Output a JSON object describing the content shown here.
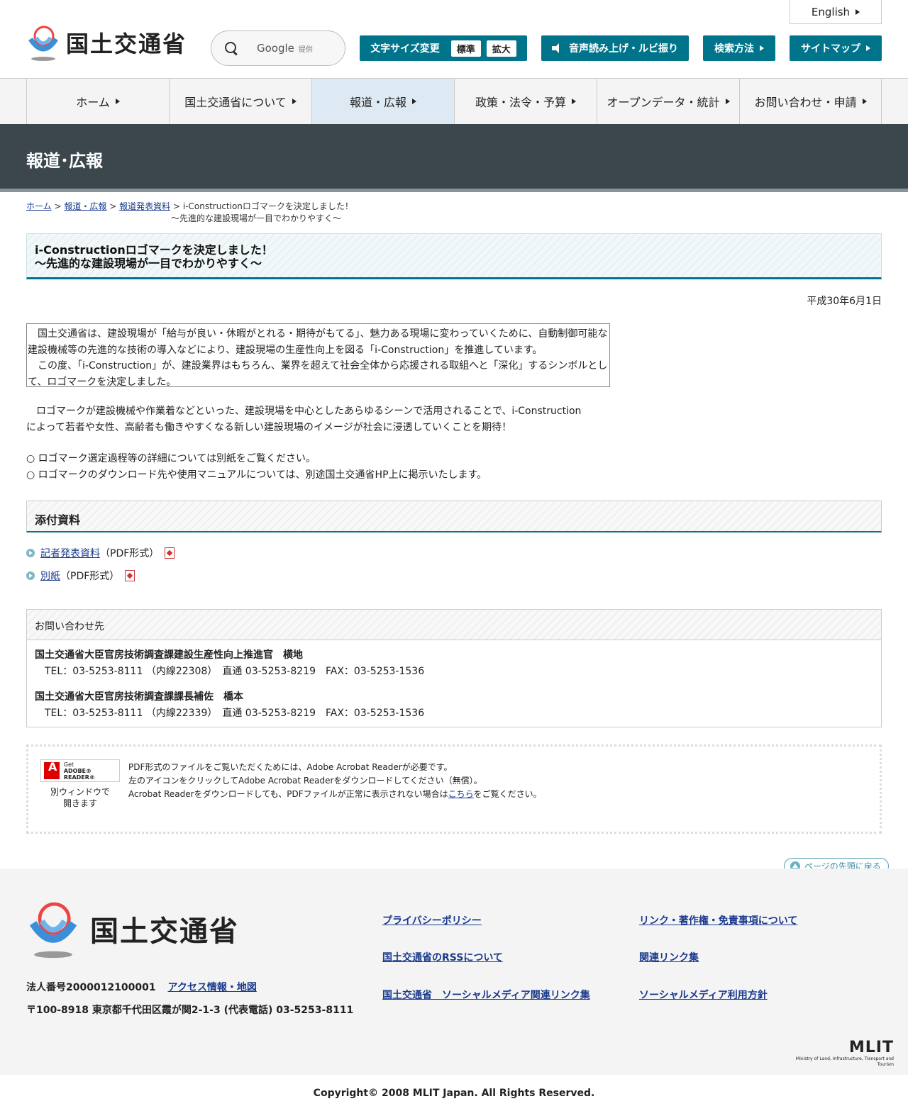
{
  "header": {
    "logo_text": "国土交通省",
    "search_brand": "Google",
    "search_sub": "提供",
    "english": "English",
    "font_size_label": "文字サイズ変更",
    "font_standard": "標準",
    "font_large": "拡大",
    "voice_ruby": "音声読み上げ・ルビ振り",
    "search_method": "検索方法",
    "sitemap": "サイトマップ"
  },
  "nav": [
    {
      "label": "ホーム"
    },
    {
      "label": "国土交通省について"
    },
    {
      "label": "報道・広報"
    },
    {
      "label": "政策・法令・予算"
    },
    {
      "label": "オープンデータ・統計"
    },
    {
      "label": "お問い合わせ・申請"
    }
  ],
  "band_title": "報道･広報",
  "breadcrumb": {
    "home": "ホーム",
    "press": "報道・広報",
    "releases": "報道発表資料",
    "sep": ">",
    "current_1": "i-Constructionロゴマークを決定しました！",
    "current_2": "～先進的な建設現場が一目でわかりやすく～"
  },
  "heading": {
    "line1": "i-Constructionロゴマークを決定しました！",
    "line2": "～先進的な建設現場が一目でわかりやすく～"
  },
  "date": "平成30年6月1日",
  "lead": {
    "p1": "国土交通省は、建設現場が「給与が良い・休暇がとれる・期待がもてる」、魅力ある現場に変わっていくために、自動制御可能な建設機械等の先進的な技術の導入などにより、建設現場の生産性向上を図る「i-Construction」を推進しています。",
    "p2": "この度、「i-Construction」が、建設業界はもちろん、業界を超えて社会全体から応援される取組へと「深化」するシンボルとして、ロゴマークを決定しました。"
  },
  "body": {
    "p1": "ロゴマークが建設機械や作業着などといった、建設現場を中心としたあらゆるシーンで活用されることで、i-Construction によって若者や女性、高齢者も働きやすくなる新しい建設現場のイメージが社会に浸透していくことを期待！",
    "b1": "○ ロゴマーク選定過程等の詳細については別紙をご覧ください。",
    "b2": "○ ロゴマークのダウンロード先や使用マニュアルについては、別途国土交通省HP上に掲示いたします。"
  },
  "attachments": {
    "title": "添付資料",
    "items": [
      {
        "label": "記者発表資料",
        "format": "（PDF形式）"
      },
      {
        "label": "別紙",
        "format": "（PDF形式）"
      }
    ]
  },
  "contact": {
    "title": "お問い合わせ先",
    "people": [
      {
        "name": "国土交通省大臣官房技術調査課建設生産性向上推進官　横地",
        "tel": "TEL：03-5253-8111 （内線22308）　直通 03-5253-8219　FAX：03-5253-1536"
      },
      {
        "name": "国土交通省大臣官房技術調査課課長補佐　橋本",
        "tel": "TEL：03-5253-8111 （内線22339）　直通 03-5253-8219　FAX：03-5253-1536"
      }
    ]
  },
  "adobe": {
    "badge_get": "Get",
    "badge_name": "ADOBE® READER®",
    "caption_1": "別ウィンドウで",
    "caption_2": "開きます",
    "line1": "PDF形式のファイルをご覧いただくためには、Adobe Acrobat Readerが必要です。",
    "line2": "左のアイコンをクリックしてAdobe Acrobat Readerをダウンロードしてください（無償）。",
    "line3_pre": "Acrobat Readerをダウンロードしても、PDFファイルが正常に表示されない場合は",
    "line3_link": "こちら",
    "line3_post": "をご覧ください。"
  },
  "to_top": "ページの先頭に戻る",
  "footer": {
    "logo_text": "国土交通省",
    "corp_no": "法人番号2000012100001",
    "access": "アクセス情報・地図",
    "address": "〒100-8918 東京都千代田区霞が関2-1-3 (代表電話) 03-5253-8111",
    "links": [
      "プライバシーポリシー",
      "リンク・著作権・免責事項について",
      "国土交通省のRSSについて",
      "関連リンク集",
      "国土交通省　ソーシャルメディア関連リンク集",
      "ソーシャルメディア利用方針"
    ],
    "mlit": "MLIT",
    "mlit_sub": "Ministry of Land, Infrastructure, Transport and Tourism",
    "copyright": "Copyright© 2008 MLIT Japan. All Rights Reserved."
  },
  "colors": {
    "accent": "#00748a",
    "band": "#3b474d",
    "link": "#1a3a8c"
  }
}
